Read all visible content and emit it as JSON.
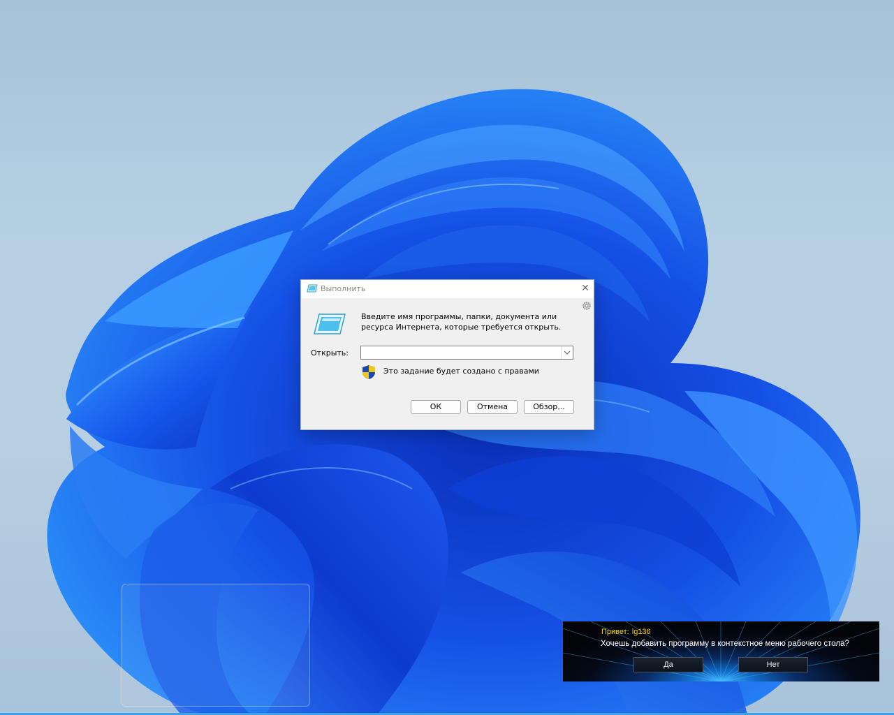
{
  "run_dialog": {
    "title": "Выполнить",
    "close_glyph": "✕",
    "description": "Введите имя программы, папки, документа или ресурса Интернета, которые требуется открыть.",
    "open_label": "Открыть:",
    "open_value": "",
    "admin_note": "Это задание будет создано с правами",
    "ok_label": "ОК",
    "cancel_label": "Отмена",
    "browse_label": "Обзор...",
    "icons": [
      "run-icon",
      "shield-icon",
      "gear-icon",
      "close-icon",
      "chevron-down-icon"
    ]
  },
  "prompt_banner": {
    "greeting": "Привет:",
    "user": "lg136",
    "question": "Хочешь добавить программу в контекстное меню рабочего стола?",
    "yes_label": "Да",
    "no_label": "Нет",
    "text_color": "#f5d31d"
  },
  "theme": {
    "wallpaper_bloom": "#1a5cf0",
    "accent": "#3ea0e8"
  }
}
